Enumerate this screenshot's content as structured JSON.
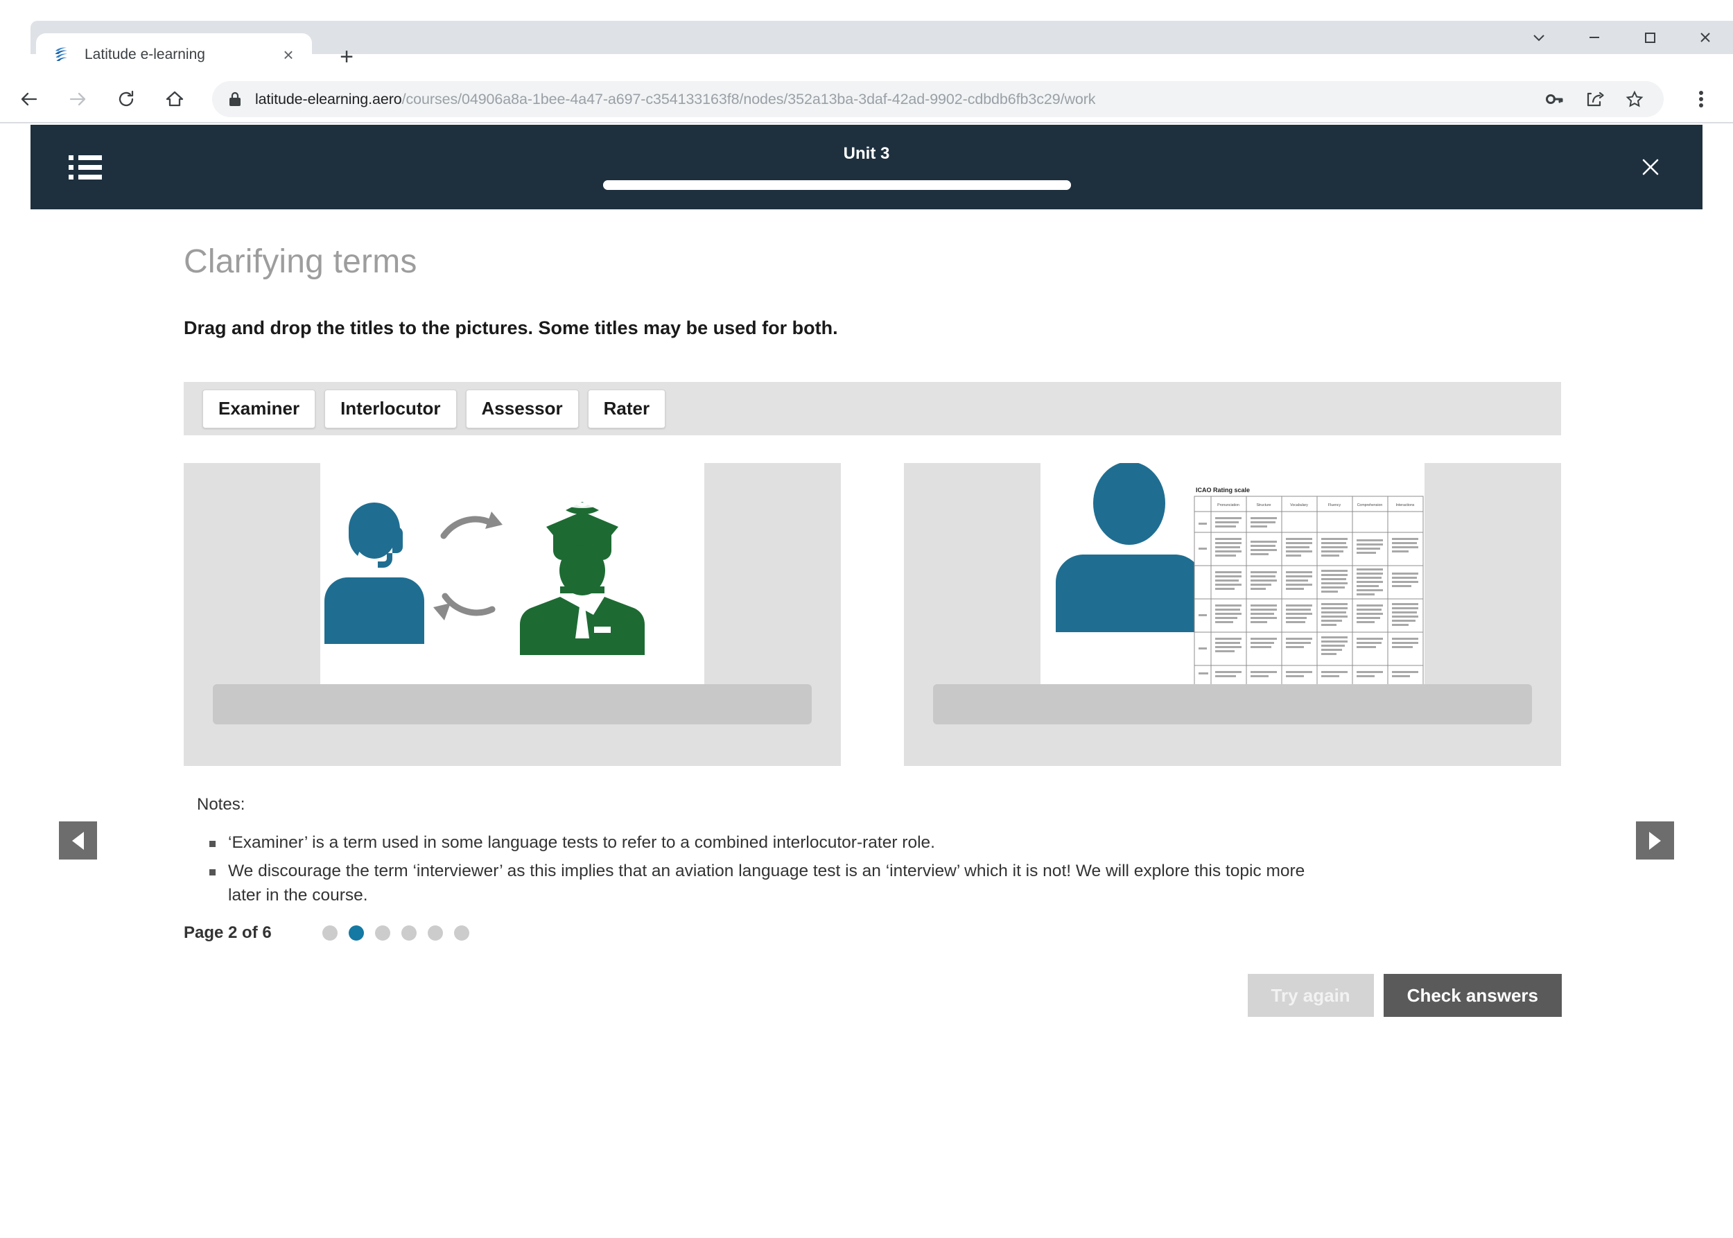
{
  "browser": {
    "tab": {
      "title": "Latitude e-learning",
      "favicon": "latitude-globe-icon",
      "close": "×"
    },
    "new_tab": "+",
    "window_controls": [
      "chevron-down",
      "minimize",
      "maximize",
      "close"
    ],
    "nav": {
      "back": "back-icon",
      "forward": "forward-icon",
      "reload": "reload-icon",
      "home": "home-icon"
    },
    "omnibox": {
      "lock": "lock-icon",
      "url_domain": "latitude-elearning.aero",
      "url_path": "/courses/04906a8a-1bee-4a47-a697-c354133163f8/nodes/352a13ba-3daf-42ad-9902-cdbdb6fb3c29/work",
      "actions": [
        "key-icon",
        "share-icon",
        "bookmark-star-icon"
      ]
    },
    "menu": "three-dot-menu-icon"
  },
  "app_header": {
    "menu_icon": "list-menu-icon",
    "title": "Unit 3",
    "progress_percent": 100,
    "close_icon": "close-icon"
  },
  "page": {
    "title": "Clarifying terms",
    "instruction": "Drag and drop the titles to the pictures. Some titles may be used for both."
  },
  "chips": [
    {
      "label": "Examiner"
    },
    {
      "label": "Interlocutor"
    },
    {
      "label": "Assessor"
    },
    {
      "label": "Rater"
    }
  ],
  "panels": [
    {
      "name": "interlocutor-picture",
      "image_description": "Blue headset operator and green uniformed pilot exchanging radio communication",
      "drop_value": ""
    },
    {
      "name": "rater-picture",
      "image_description": "Blue person silhouette beside an ICAO language proficiency rating scale table",
      "drop_value": ""
    }
  ],
  "notes": {
    "label": "Notes:",
    "items": [
      "‘Examiner’ is a term used in some language tests to refer to a combined interlocutor-rater role.",
      "We discourage the term ‘interviewer’ as this implies that an aviation language test is an ‘interview’ which it is not! We will explore this topic more later in the course."
    ]
  },
  "pagination": {
    "label": "Page 2 of 6",
    "total": 6,
    "current": 2,
    "active_color": "#1479a3",
    "inactive_color": "#cccccc"
  },
  "carousel": {
    "prev": "prev-arrow-icon",
    "next": "next-arrow-icon"
  },
  "actions": {
    "try_again": "Try again",
    "check_answers": "Check answers"
  },
  "rating_scale": {
    "title": "ICAO Rating scale",
    "columns": [
      "Pronunciation",
      "Structure",
      "Vocabulary",
      "Fluency",
      "Comprehension",
      "Interactions"
    ]
  },
  "colors": {
    "header_bg": "#1e303e",
    "accent_blue": "#1479a3",
    "figure_blue": "#1f6e91",
    "figure_green": "#1d6b33",
    "tray_bg": "#e2e2e2",
    "panel_bg": "#e0e0e0",
    "dropzone_bg": "#c8c8c8",
    "primary_btn": "#5a5a5a",
    "secondary_btn": "#d4d4d4"
  }
}
